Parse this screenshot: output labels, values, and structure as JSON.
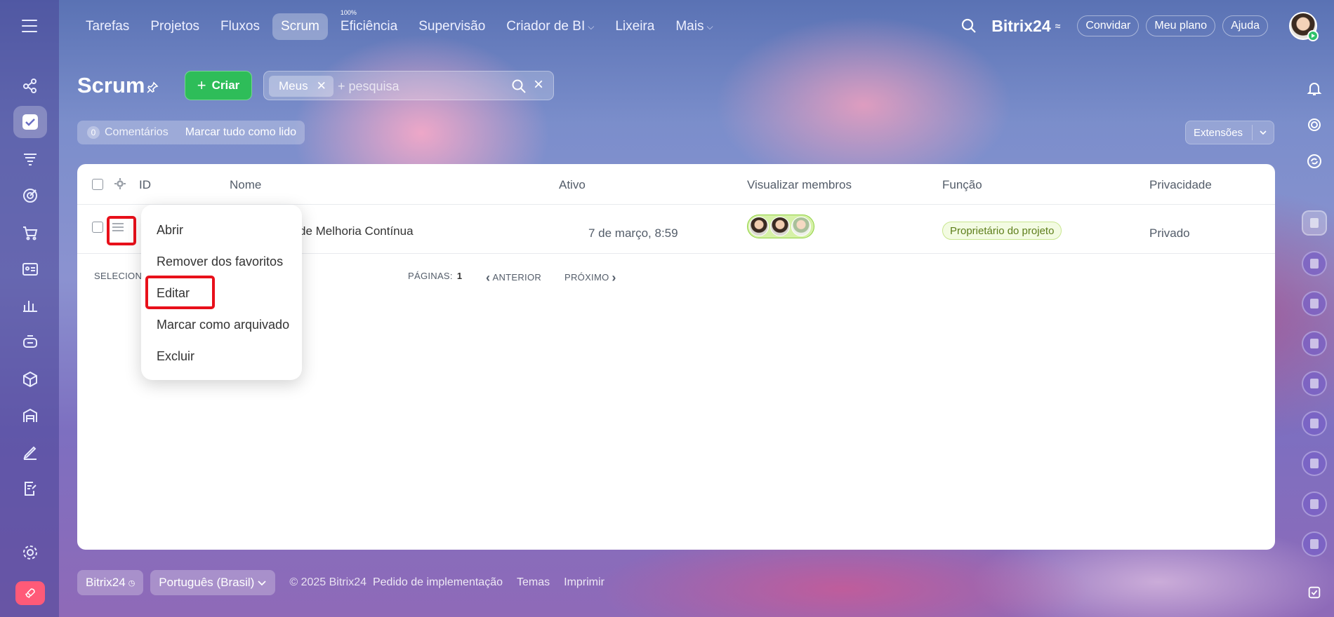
{
  "top_nav": {
    "items": [
      {
        "label": "Tarefas"
      },
      {
        "label": "Projetos"
      },
      {
        "label": "Fluxos"
      },
      {
        "label": "Scrum"
      },
      {
        "label": "Eficiência",
        "badge": "100%"
      },
      {
        "label": "Supervisão"
      },
      {
        "label": "Criador de BI",
        "caret": "⌵"
      },
      {
        "label": "Lixeira"
      },
      {
        "label": "Mais",
        "caret": "⌵"
      }
    ],
    "active": "Scrum"
  },
  "header_right": {
    "brand": "Bitrix24",
    "invite": "Convidar",
    "my_plan": "Meu plano",
    "help": "Ajuda"
  },
  "page": {
    "title": "Scrum",
    "create_label": "Criar",
    "filter_tag": "Meus",
    "search_placeholder": "+ pesquisa"
  },
  "counter": {
    "count": "0",
    "label": "Comentários",
    "mark_all": "Marcar tudo como lido"
  },
  "extensions": "Extensões",
  "grid": {
    "columns": [
      "ID",
      "Nome",
      "Ativo",
      "Visualizar membros",
      "Função",
      "Privacidade"
    ],
    "rows": [
      {
        "name": "de Melhoria Contínua",
        "active": "7 de março, 8:59",
        "role": "Proprietário do projeto",
        "privacy": "Privado"
      }
    ],
    "footer": {
      "selected_label": "SELECIONA",
      "pages_label": "PÁGINAS:",
      "pages_value": "1",
      "prev": "ANTERIOR",
      "next": "PRÓXIMO"
    }
  },
  "context_menu": {
    "items": [
      "Abrir",
      "Remover dos favoritos",
      "Editar",
      "Marcar como arquivado",
      "Excluir"
    ]
  },
  "footer": {
    "brand": "Bitrix24",
    "language": "Português (Brasil)",
    "copyright": "© 2025 Bitrix24",
    "links": [
      "Pedido de implementação",
      "Temas",
      "Imprimir"
    ]
  },
  "colors": {
    "create_green": "#2ebd59",
    "highlight_red": "#e8101a",
    "role_green": "#5d7e1a"
  }
}
